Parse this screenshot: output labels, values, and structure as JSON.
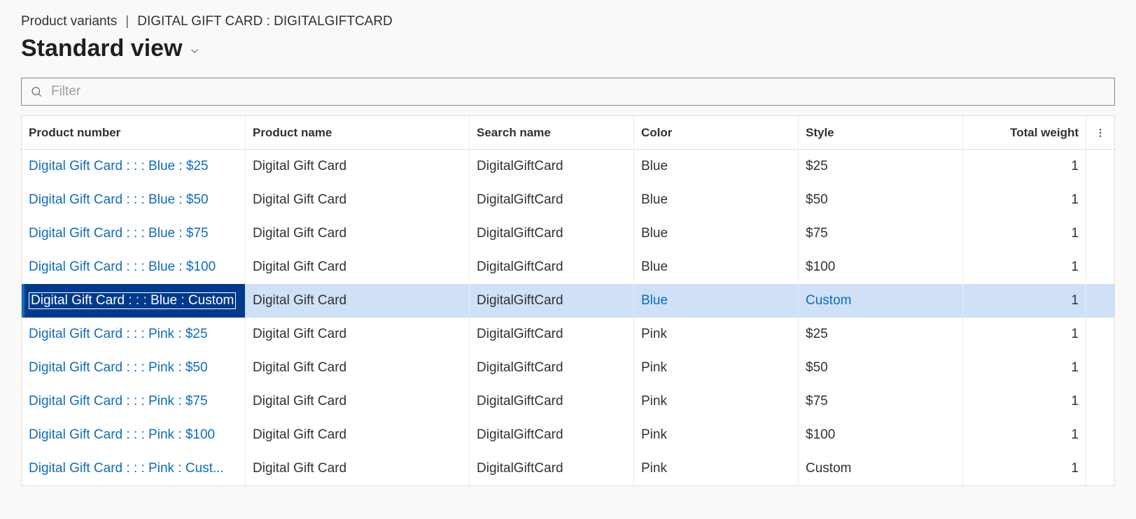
{
  "breadcrumb": {
    "section": "Product variants",
    "separator": "|",
    "record": "DIGITAL GIFT CARD : DIGITALGIFTCARD"
  },
  "view_title": "Standard view",
  "filter": {
    "placeholder": "Filter",
    "value": ""
  },
  "columns": {
    "product_number": "Product number",
    "product_name": "Product name",
    "search_name": "Search name",
    "color": "Color",
    "style": "Style",
    "total_weight": "Total weight"
  },
  "rows": [
    {
      "product_number": "Digital Gift Card :  :  : Blue : $25",
      "product_name": "Digital Gift Card",
      "search_name": "DigitalGiftCard",
      "color": "Blue",
      "style": "$25",
      "total_weight": "1",
      "selected": false
    },
    {
      "product_number": "Digital Gift Card :  :  : Blue : $50",
      "product_name": "Digital Gift Card",
      "search_name": "DigitalGiftCard",
      "color": "Blue",
      "style": "$50",
      "total_weight": "1",
      "selected": false
    },
    {
      "product_number": "Digital Gift Card :  :  : Blue : $75",
      "product_name": "Digital Gift Card",
      "search_name": "DigitalGiftCard",
      "color": "Blue",
      "style": "$75",
      "total_weight": "1",
      "selected": false
    },
    {
      "product_number": "Digital Gift Card :  :  : Blue : $100",
      "product_name": "Digital Gift Card",
      "search_name": "DigitalGiftCard",
      "color": "Blue",
      "style": "$100",
      "total_weight": "1",
      "selected": false
    },
    {
      "product_number": "Digital Gift Card :  :  : Blue : Custom",
      "product_name": "Digital Gift Card",
      "search_name": "DigitalGiftCard",
      "color": "Blue",
      "style": "Custom",
      "total_weight": "1",
      "selected": true
    },
    {
      "product_number": "Digital Gift Card :  :  : Pink : $25",
      "product_name": "Digital Gift Card",
      "search_name": "DigitalGiftCard",
      "color": "Pink",
      "style": "$25",
      "total_weight": "1",
      "selected": false
    },
    {
      "product_number": "Digital Gift Card :  :  : Pink : $50",
      "product_name": "Digital Gift Card",
      "search_name": "DigitalGiftCard",
      "color": "Pink",
      "style": "$50",
      "total_weight": "1",
      "selected": false
    },
    {
      "product_number": "Digital Gift Card :  :  : Pink : $75",
      "product_name": "Digital Gift Card",
      "search_name": "DigitalGiftCard",
      "color": "Pink",
      "style": "$75",
      "total_weight": "1",
      "selected": false
    },
    {
      "product_number": "Digital Gift Card :  :  : Pink : $100",
      "product_name": "Digital Gift Card",
      "search_name": "DigitalGiftCard",
      "color": "Pink",
      "style": "$100",
      "total_weight": "1",
      "selected": false
    },
    {
      "product_number": "Digital Gift Card :  :  : Pink : Cust...",
      "product_name": "Digital Gift Card",
      "search_name": "DigitalGiftCard",
      "color": "Pink",
      "style": "Custom",
      "total_weight": "1",
      "selected": false
    }
  ]
}
